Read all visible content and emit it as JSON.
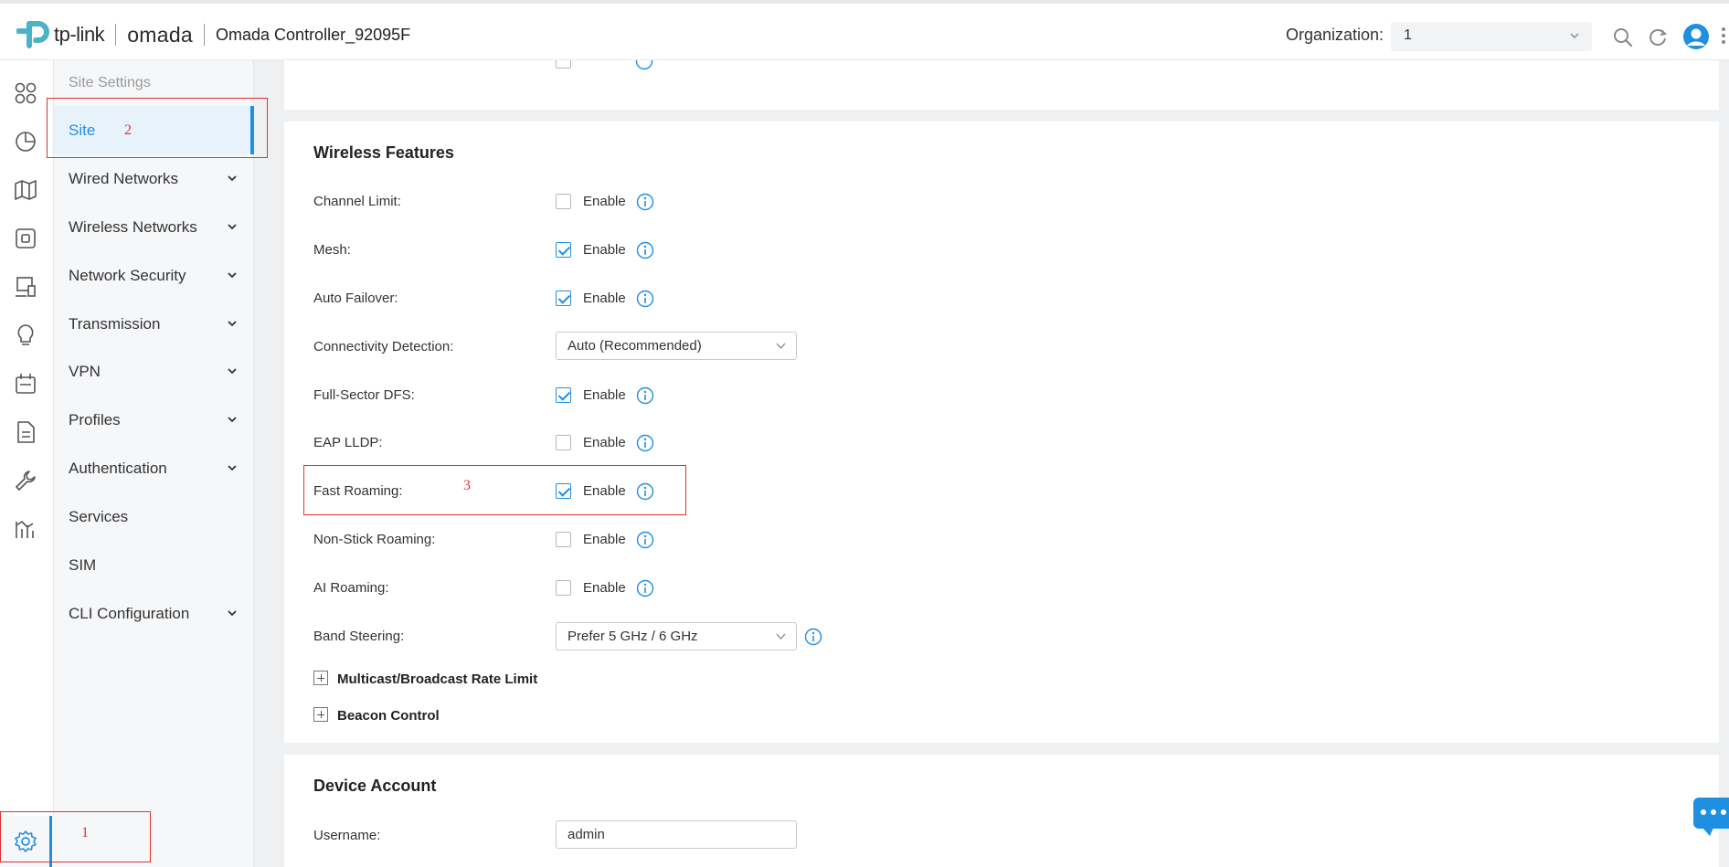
{
  "header": {
    "brand": "tp-link",
    "product": "omada",
    "controller_title": "Omada Controller_92095F",
    "org_label": "Organization:",
    "org_value": "1"
  },
  "sidebar": {
    "header": "Site Settings",
    "items": [
      {
        "label": "Site",
        "expandable": false,
        "active": true
      },
      {
        "label": "Wired Networks",
        "expandable": true
      },
      {
        "label": "Wireless Networks",
        "expandable": true
      },
      {
        "label": "Network Security",
        "expandable": true
      },
      {
        "label": "Transmission",
        "expandable": true
      },
      {
        "label": "VPN",
        "expandable": true
      },
      {
        "label": "Profiles",
        "expandable": true
      },
      {
        "label": "Authentication",
        "expandable": true
      },
      {
        "label": "Services",
        "expandable": false
      },
      {
        "label": "SIM",
        "expandable": false
      },
      {
        "label": "CLI Configuration",
        "expandable": true
      }
    ]
  },
  "wireless_features": {
    "title": "Wireless Features",
    "enable_label": "Enable",
    "rows": [
      {
        "label": "Channel Limit:",
        "type": "checkbox",
        "checked": false
      },
      {
        "label": "Mesh:",
        "type": "checkbox",
        "checked": true
      },
      {
        "label": "Auto Failover:",
        "type": "checkbox",
        "checked": true
      },
      {
        "label": "Connectivity Detection:",
        "type": "select",
        "value": "Auto (Recommended)"
      },
      {
        "label": "Full-Sector DFS:",
        "type": "checkbox",
        "checked": true
      },
      {
        "label": "EAP LLDP:",
        "type": "checkbox",
        "checked": false
      },
      {
        "label": "Fast Roaming:",
        "type": "checkbox",
        "checked": true
      },
      {
        "label": "Non-Stick Roaming:",
        "type": "checkbox",
        "checked": false
      },
      {
        "label": "AI Roaming:",
        "type": "checkbox",
        "checked": false
      },
      {
        "label": "Band Steering:",
        "type": "select",
        "value": "Prefer 5 GHz / 6 GHz"
      }
    ],
    "expanders": [
      "Multicast/Broadcast Rate Limit",
      "Beacon Control"
    ]
  },
  "device_account": {
    "title": "Device Account",
    "username_label": "Username:",
    "username_value": "admin"
  },
  "annotations": [
    "1",
    "2",
    "3"
  ],
  "colors": {
    "accent": "#1f8fe0",
    "annotation": "#e23030",
    "sidebar_bg": "#f6f7f9",
    "content_bg": "#eef0f2"
  }
}
